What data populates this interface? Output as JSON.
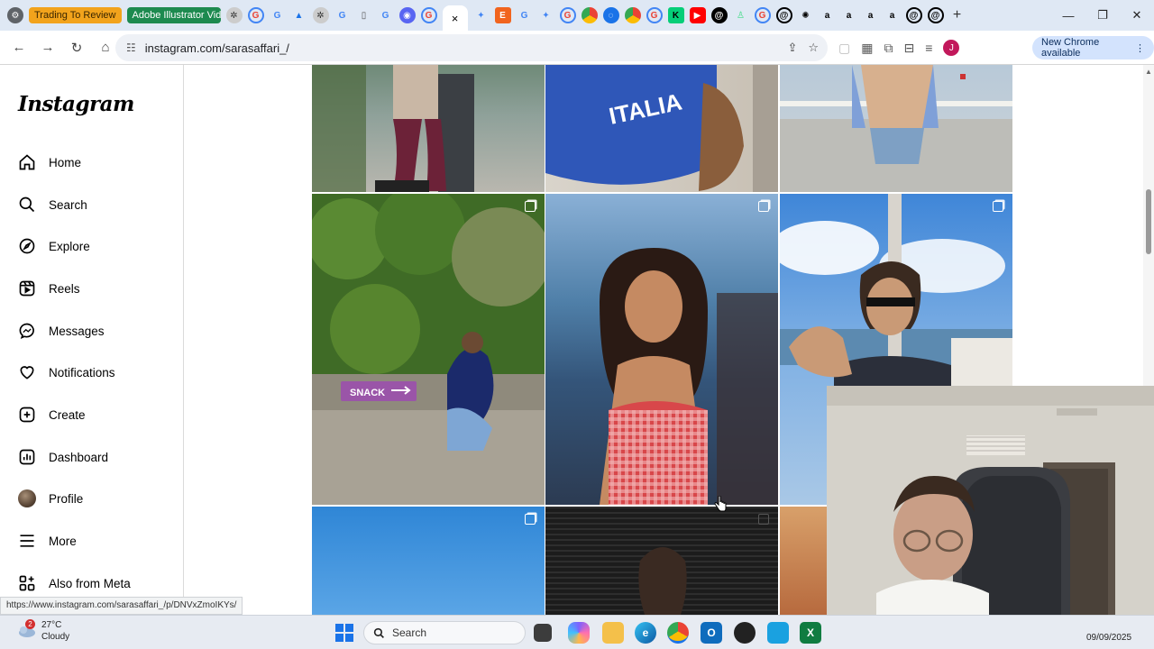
{
  "browser": {
    "pinned_tab_1": "Trading To Review",
    "pinned_tab_2": "Adobe Illustrator Vide",
    "active_tab_close": "×",
    "new_tab": "+",
    "url": "instagram.com/sarasaffari_/",
    "update_label": "New Chrome available",
    "profile_initial": "J",
    "status_url": "https://www.instagram.com/sarasaffari_/p/DNVxZmoIKYs/"
  },
  "instagram": {
    "logo": "Instagram",
    "nav": {
      "home": "Home",
      "search": "Search",
      "explore": "Explore",
      "reels": "Reels",
      "messages": "Messages",
      "notifications": "Notifications",
      "create": "Create",
      "dashboard": "Dashboard",
      "profile": "Profile",
      "more": "More",
      "also_from_meta": "Also from Meta"
    },
    "posts": [
      {
        "caption_sign": "SNACK"
      },
      {
        "shirt_text": "ITALIA"
      }
    ]
  },
  "taskbar": {
    "weather_temp": "27°C",
    "weather_desc": "Cloudy",
    "weather_badge": "2",
    "search_label": "Search",
    "date": "09/09/2025"
  },
  "colors": {
    "pinned_tab_1": "#f2a31c",
    "pinned_tab_2": "#1d8a4f",
    "update_pill": "#d3e3fd",
    "profile_avatar": "#c2185b"
  }
}
